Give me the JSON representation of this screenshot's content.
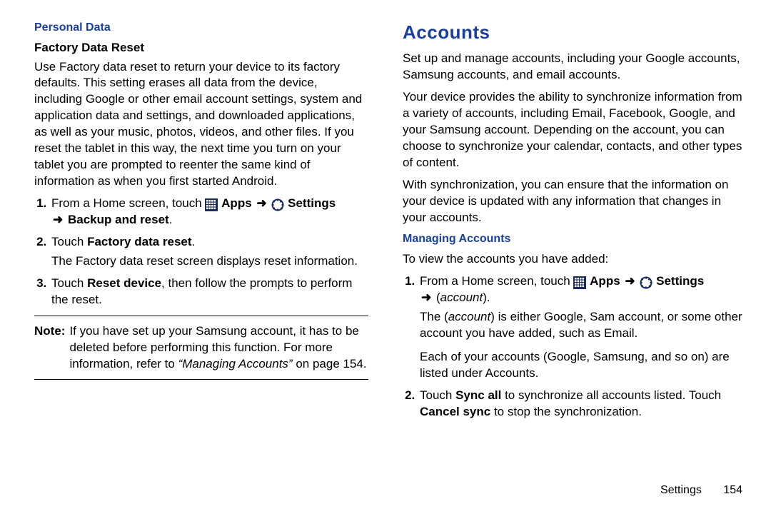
{
  "left": {
    "section_title": "Personal Data",
    "h3": "Factory Data Reset",
    "intro": "Use Factory data reset to return your device to its factory defaults. This setting erases all data from the device, including Google or other email account settings, system and application data and settings, and downloaded applications, as well as your music, photos, videos, and other files. If you reset the tablet in this way, the next time you turn on your tablet you are prompted to reenter the same kind of information as when you first started Android.",
    "step1_a": "From a Home screen, touch ",
    "apps_label": "Apps",
    "settings_label": "Settings",
    "step1_b": "Backup and reset",
    "step1_b_suffix": ".",
    "step2_a": "Touch ",
    "step2_bold": "Factory data reset",
    "step2_suffix": ".",
    "step2_sub": "The Factory data reset screen displays reset information.",
    "step3_a": "Touch ",
    "step3_bold": "Reset device",
    "step3_b": ", then follow the prompts to perform the reset.",
    "note_label": "Note:",
    "note_a": "If you have set up your Samsung account, it has to be deleted before performing this function. For more information, refer to ",
    "note_ref": "“Managing Accounts”",
    "note_b": " on page 154."
  },
  "right": {
    "h2": "Accounts",
    "p1": "Set up and manage accounts, including your Google accounts, Samsung accounts, and email accounts.",
    "p2": "Your device provides the ability to synchronize information from a variety of accounts, including Email, Facebook, Google, and your Samsung account. Depending on the account, you can choose to synchronize your calendar, contacts, and other types of content.",
    "p3": "With synchronization, you can ensure that the information on your device is updated with any information that changes in your accounts.",
    "managing_h": "Managing Accounts",
    "managing_lead": "To view the accounts you have added:",
    "step1_a": "From a Home screen, touch ",
    "apps_label": "Apps",
    "settings_label": "Settings",
    "step1_b": "(",
    "step1_account": "account",
    "step1_b_end": ").",
    "step1_sub_a": "The (",
    "step1_sub_account": "account",
    "step1_sub_b": ") is either Google, Sam account, or some other account you have added, such as Email.",
    "step1_sub2": "Each of your accounts (Google, Samsung, and so on) are listed under Accounts.",
    "step2_a": "Touch ",
    "step2_bold1": "Sync all",
    "step2_mid": " to synchronize all accounts listed. Touch ",
    "step2_bold2": "Cancel sync",
    "step2_end": " to stop the synchronization."
  },
  "footer": {
    "section": "Settings",
    "page": "154"
  },
  "arrow": "➜"
}
